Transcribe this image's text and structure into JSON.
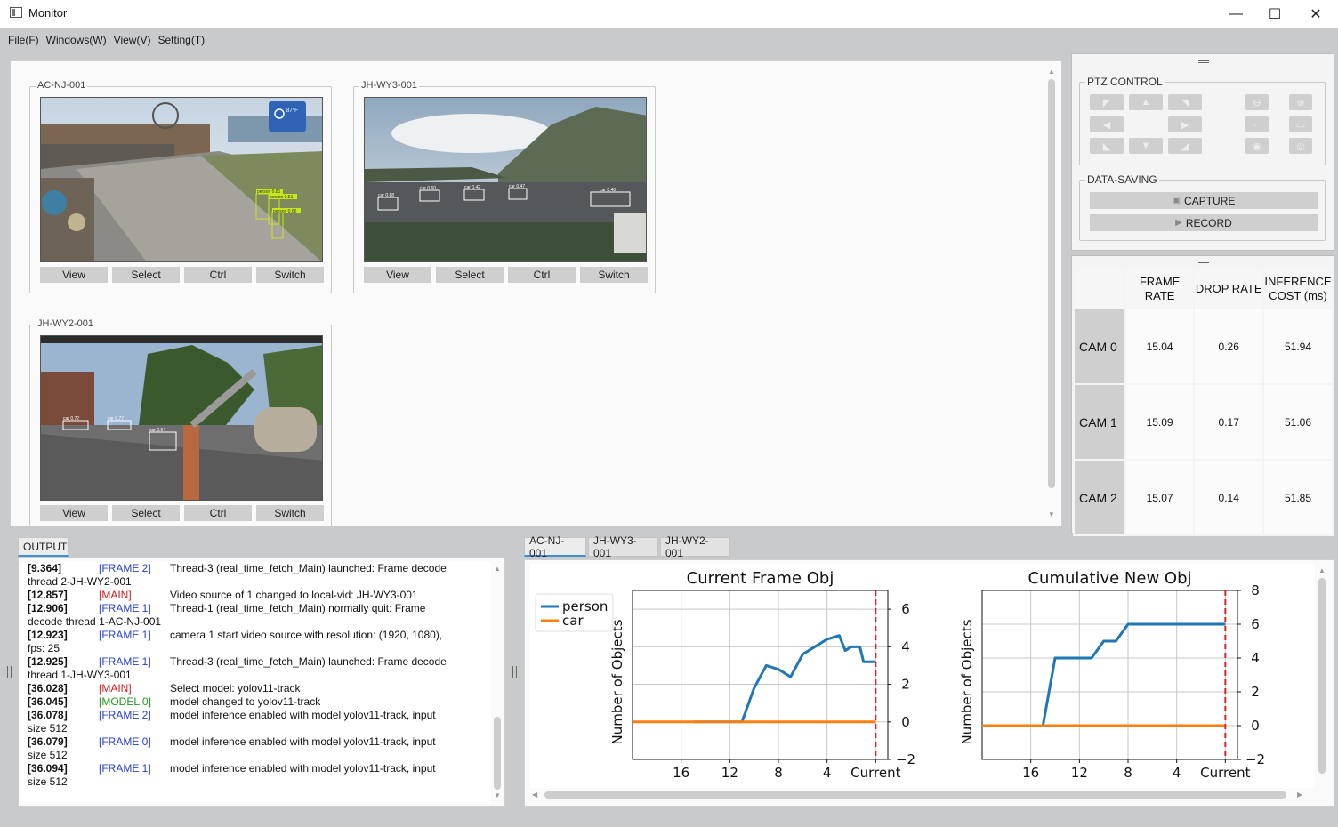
{
  "window": {
    "title": "Monitor",
    "minimize": "—",
    "maximize": "☐",
    "close": "✕"
  },
  "menu": [
    "File(F)",
    "Windows(W)",
    "View(V)",
    "Setting(T)"
  ],
  "cameras": [
    {
      "name": "AC-NJ-001",
      "buttons": [
        "View",
        "Select",
        "Ctrl",
        "Switch"
      ],
      "labels": [
        "person 0.81",
        "person 0.51",
        "person 0.66"
      ],
      "overlay": "87°F"
    },
    {
      "name": "JH-WY3-001",
      "buttons": [
        "View",
        "Select",
        "Ctrl",
        "Switch"
      ],
      "labels": [
        "car 0.88",
        "car 0.60",
        "car 0.42",
        "car 0.47",
        "car 0.46"
      ]
    },
    {
      "name": "JH-WY2-001",
      "buttons": [
        "View",
        "Select",
        "Ctrl",
        "Switch"
      ],
      "labels": [
        "car 0.72",
        "car 0.77",
        "car 0.64"
      ]
    }
  ],
  "ptz": {
    "title": "PTZ CONTROL",
    "buttons": [
      "up-left",
      "up",
      "up-right",
      "left",
      "right",
      "down-left",
      "down",
      "down-right",
      "zoom-out",
      "zoom-in",
      "focus-near",
      "focus-far",
      "iris-close",
      "iris-open"
    ]
  },
  "data_saving": {
    "title": "DATA-SAVING",
    "capture": "CAPTURE",
    "record": "RECORD"
  },
  "stats": {
    "headers": [
      "FRAME RATE",
      "DROP RATE",
      "INFERENCE COST (ms)"
    ],
    "rows": [
      {
        "cam": "CAM 0",
        "frame_rate": "15.04",
        "drop_rate": "0.26",
        "inference": "51.94"
      },
      {
        "cam": "CAM 1",
        "frame_rate": "15.09",
        "drop_rate": "0.17",
        "inference": "51.06"
      },
      {
        "cam": "CAM 2",
        "frame_rate": "15.07",
        "drop_rate": "0.14",
        "inference": "51.85"
      }
    ]
  },
  "output": {
    "tab": "OUTPUT",
    "lines": [
      {
        "t": "[9.364]",
        "tag": "[FRAME 2]",
        "kind": "frame",
        "msg": "Thread-3 (real_time_fetch_Main) launched: Frame decode",
        "cont": "thread 2-JH-WY2-001"
      },
      {
        "t": "[12.857]",
        "tag": "[MAIN]",
        "kind": "main",
        "msg": "Video source of 1 changed to local-vid: JH-WY3-001",
        "cont": ""
      },
      {
        "t": "[12.906]",
        "tag": "[FRAME 1]",
        "kind": "frame",
        "msg": "Thread-1 (real_time_fetch_Main) normally quit: Frame",
        "cont": "decode thread 1-AC-NJ-001"
      },
      {
        "t": "[12.923]",
        "tag": "[FRAME 1]",
        "kind": "frame",
        "msg": "camera 1 start video source with resolution: (1920, 1080),",
        "cont": "fps: 25"
      },
      {
        "t": "[12.925]",
        "tag": "[FRAME 1]",
        "kind": "frame",
        "msg": "Thread-3 (real_time_fetch_Main) launched: Frame decode",
        "cont": "thread 1-JH-WY3-001"
      },
      {
        "t": "[36.028]",
        "tag": "[MAIN]",
        "kind": "main",
        "msg": "Select model: yolov11-track",
        "cont": ""
      },
      {
        "t": "[36.045]",
        "tag": "[MODEL 0]",
        "kind": "model",
        "msg": "model changed to yolov11-track",
        "cont": ""
      },
      {
        "t": "[36.078]",
        "tag": "[FRAME 2]",
        "kind": "frame",
        "msg": "model inference enabled with model yolov11-track, input",
        "cont": "size 512"
      },
      {
        "t": "[36.079]",
        "tag": "[FRAME 0]",
        "kind": "frame",
        "msg": "model inference enabled with model yolov11-track, input",
        "cont": "size 512"
      },
      {
        "t": "[36.094]",
        "tag": "[FRAME 1]",
        "kind": "frame",
        "msg": "model inference enabled with model yolov11-track, input",
        "cont": "size 512"
      }
    ]
  },
  "chart_tabs": [
    "AC-NJ-001",
    "JH-WY3-001",
    "JH-WY2-001"
  ],
  "chart_data": [
    {
      "type": "line",
      "title": "Current Frame Obj",
      "ylabel": "Number of Objects",
      "xlabel": "",
      "x": [
        19,
        18,
        17,
        16,
        15,
        14,
        13,
        12,
        11,
        10,
        9,
        8,
        7,
        6,
        5,
        4,
        3,
        2,
        1,
        0
      ],
      "xticks": [
        "16",
        "12",
        "8",
        "4",
        "Current"
      ],
      "xtick_values": [
        16,
        12,
        8,
        4,
        0
      ],
      "xlim": [
        20,
        -1
      ],
      "ylim": [
        -2,
        7
      ],
      "yticks": [
        -2,
        0,
        2,
        4,
        6
      ],
      "yaxis_side": "right",
      "grid": true,
      "legend": "upper-left-outside",
      "vline": {
        "x": 0,
        "color": "#d62728",
        "style": "dashed"
      },
      "series": [
        {
          "name": "person",
          "color": "#1f77b4",
          "values": [
            0,
            0,
            0,
            0,
            0,
            0,
            0,
            0,
            0,
            1.8,
            3.0,
            2.8,
            2.4,
            3.6,
            4.0,
            4.4,
            4.6,
            3.8,
            4.0,
            4.0,
            4.0,
            4.0,
            3.2,
            3.2
          ],
          "x": [
            15,
            14.5,
            14,
            13.5,
            13,
            12.5,
            12,
            11.5,
            11,
            10,
            9,
            8,
            7,
            6,
            5,
            4,
            3,
            2.5,
            2,
            1.8,
            1.5,
            1.3,
            1,
            0
          ]
        },
        {
          "name": "car",
          "color": "#ff7f0e",
          "values": [
            0,
            0
          ],
          "x": [
            20,
            0
          ]
        }
      ]
    },
    {
      "type": "line",
      "title": "Cumulative New Obj",
      "ylabel": "Number of Objects",
      "xlabel": "",
      "xticks": [
        "16",
        "12",
        "8",
        "4",
        "Current"
      ],
      "xtick_values": [
        16,
        12,
        8,
        4,
        0
      ],
      "xlim": [
        20,
        -1
      ],
      "ylim": [
        -2,
        8
      ],
      "yticks": [
        -2,
        0,
        2,
        4,
        6,
        8
      ],
      "yaxis_side": "right",
      "grid": true,
      "vline": {
        "x": 0,
        "color": "#d62728",
        "style": "dashed"
      },
      "series": [
        {
          "name": "person",
          "color": "#1f77b4",
          "x": [
            20,
            15,
            14,
            13,
            12,
            11,
            10,
            9.5,
            9,
            8,
            7,
            0
          ],
          "values": [
            0,
            0,
            4,
            4,
            4,
            4,
            5,
            5,
            5,
            6,
            6,
            6
          ]
        },
        {
          "name": "car",
          "color": "#ff7f0e",
          "x": [
            20,
            0
          ],
          "values": [
            0,
            0
          ]
        }
      ]
    }
  ]
}
